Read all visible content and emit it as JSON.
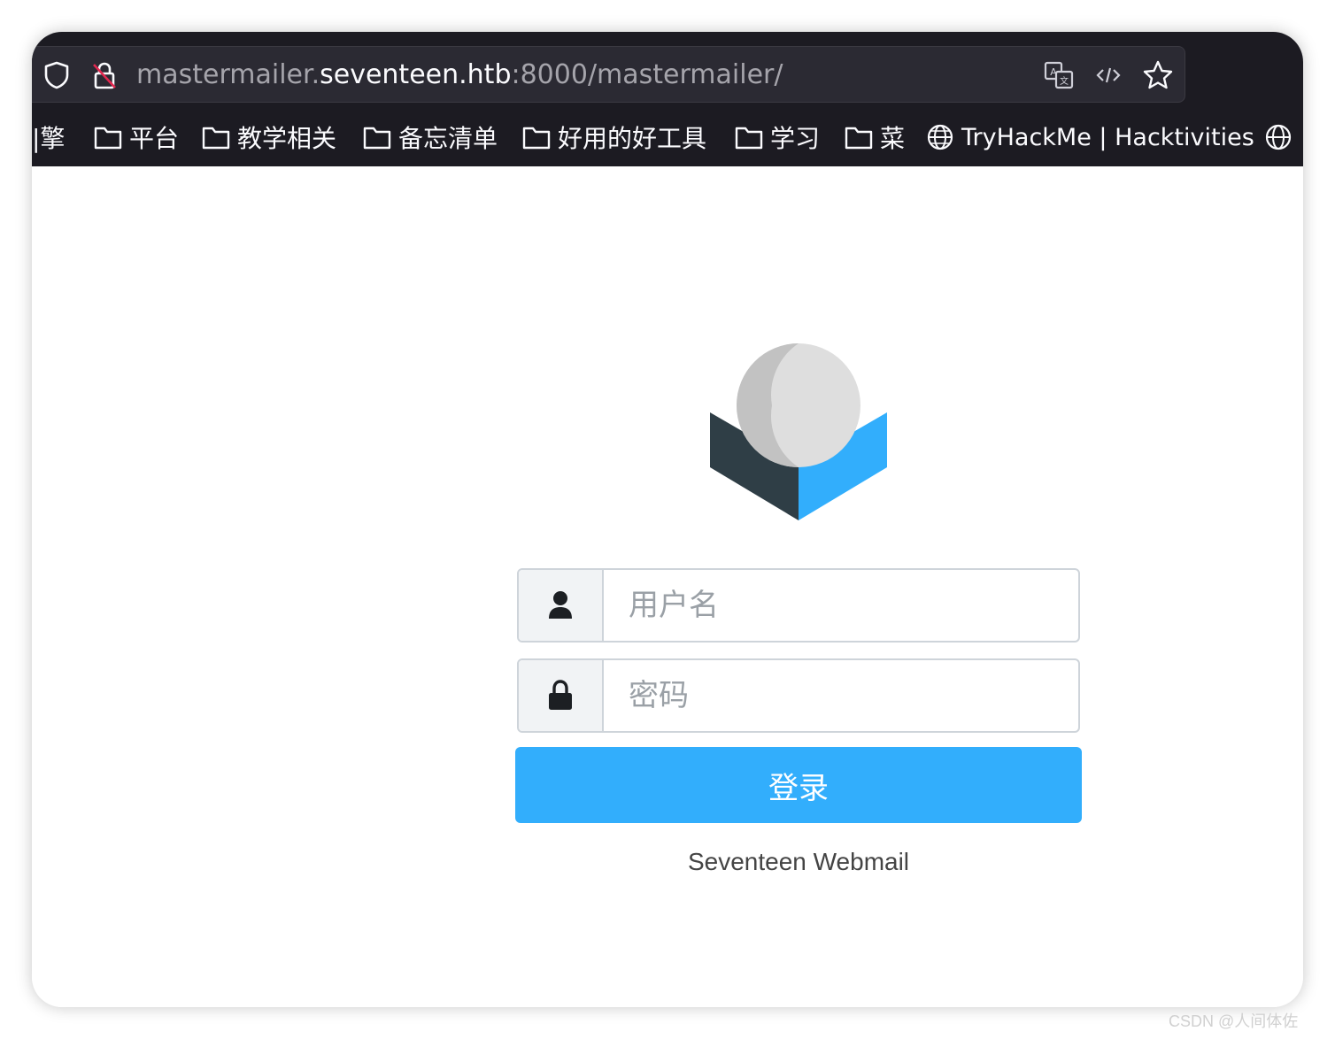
{
  "browser": {
    "url": {
      "prefix": "mastermailer.",
      "domain": "seventeen.htb",
      "suffix": ":8000/mastermailer/"
    },
    "icons": {
      "site_info": "shield-icon",
      "insecure": "lock-slash-icon",
      "translate": "translate-icon",
      "reader": "code-icon",
      "bookmark_star": "star-icon"
    },
    "bookmarks": [
      {
        "label": "|擎",
        "icon": "none"
      },
      {
        "label": "平台",
        "icon": "folder-icon"
      },
      {
        "label": "教学相关",
        "icon": "folder-icon"
      },
      {
        "label": "备忘清单",
        "icon": "folder-icon"
      },
      {
        "label": "好用的好工具",
        "icon": "folder-icon"
      },
      {
        "label": "学习",
        "icon": "folder-icon"
      },
      {
        "label": "菜",
        "icon": "folder-icon"
      },
      {
        "label": "TryHackMe | Hacktivities",
        "icon": "globe-icon"
      },
      {
        "label": "",
        "icon": "globe-icon"
      }
    ]
  },
  "login": {
    "username_placeholder": "用户名",
    "password_placeholder": "密码",
    "submit_label": "登录",
    "product_name": "Seventeen Webmail"
  },
  "watermark": "CSDN @人间体佐",
  "colors": {
    "accent": "#32aefc",
    "toolbar_bg": "#1c1b22",
    "logo_dark": "#2f3e46"
  }
}
